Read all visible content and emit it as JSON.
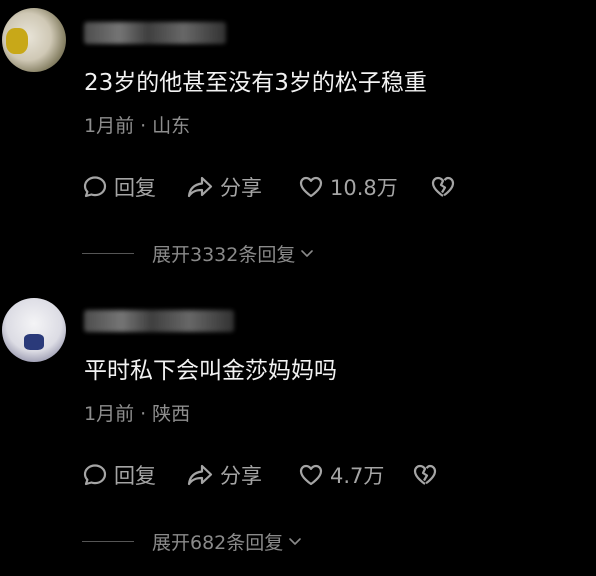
{
  "comments": [
    {
      "text": "23岁的他甚至没有3岁的松子稳重",
      "time": "1月前",
      "separator": "·",
      "location": "山东",
      "reply_label": "回复",
      "share_label": "分享",
      "like_count": "10.8万",
      "expand_label": "展开3332条回复"
    },
    {
      "text": "平时私下会叫金莎妈妈吗",
      "time": "1月前",
      "separator": "·",
      "location": "陕西",
      "reply_label": "回复",
      "share_label": "分享",
      "like_count": "4.7万",
      "expand_label": "展开682条回复"
    }
  ],
  "icons": {
    "reply": "speech-bubble-icon",
    "share": "share-arrow-icon",
    "like": "heart-outline-icon",
    "dislike": "broken-heart-icon",
    "expand": "chevron-down-icon"
  },
  "colors": {
    "background": "#000000",
    "text_primary": "#f2f2f2",
    "text_secondary": "#8e8e8e",
    "icon": "#a5a5a5"
  }
}
